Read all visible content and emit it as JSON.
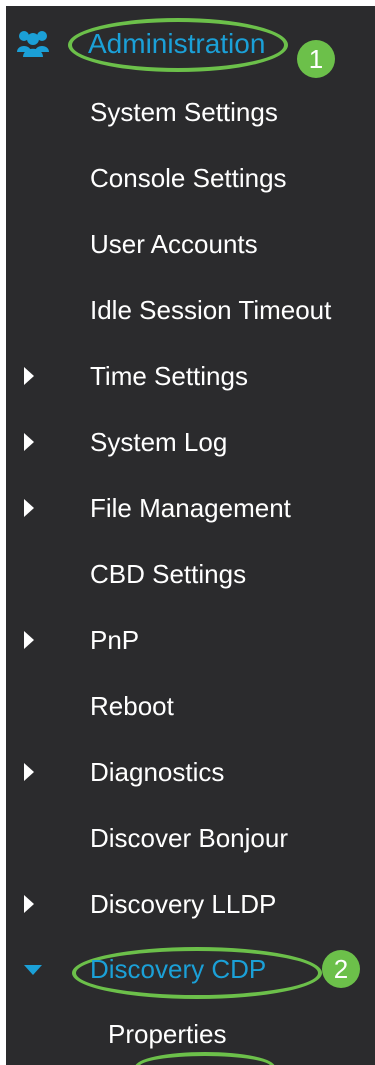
{
  "nav": {
    "section": {
      "label": "Administration",
      "icon": "users-icon",
      "badge": "1"
    },
    "items": [
      {
        "label": "System Settings",
        "expandable": false
      },
      {
        "label": "Console Settings",
        "expandable": false
      },
      {
        "label": "User Accounts",
        "expandable": false
      },
      {
        "label": "Idle Session Timeout",
        "expandable": false
      },
      {
        "label": "Time Settings",
        "expandable": true,
        "expanded": false
      },
      {
        "label": "System Log",
        "expandable": true,
        "expanded": false
      },
      {
        "label": "File Management",
        "expandable": true,
        "expanded": false
      },
      {
        "label": "CBD Settings",
        "expandable": false
      },
      {
        "label": "PnP",
        "expandable": true,
        "expanded": false
      },
      {
        "label": "Reboot",
        "expandable": false
      },
      {
        "label": "Diagnostics",
        "expandable": true,
        "expanded": false
      },
      {
        "label": "Discover Bonjour",
        "expandable": false
      },
      {
        "label": "Discovery LLDP",
        "expandable": true,
        "expanded": false
      },
      {
        "label": "Discovery CDP",
        "expandable": true,
        "expanded": true,
        "badge": "2"
      }
    ],
    "subitems": [
      {
        "label": "Properties"
      }
    ]
  },
  "colors": {
    "background": "#2b2b2d",
    "active_text": "#1ba0d7",
    "highlight": "#6cc04a",
    "text": "#ffffff"
  }
}
